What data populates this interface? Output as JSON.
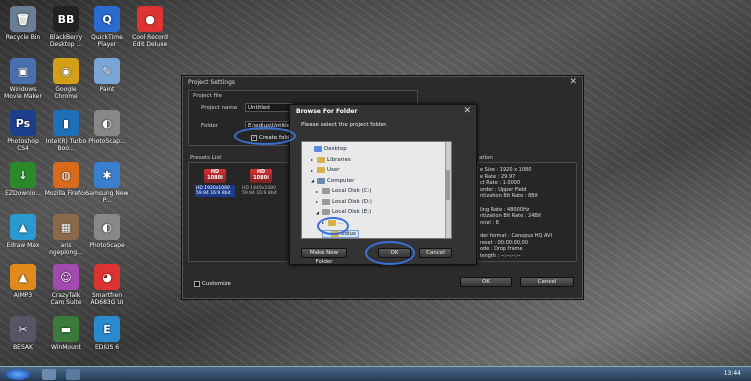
{
  "desktop": {
    "icons": [
      {
        "label": "Recycle Bin",
        "glyph": "🗑",
        "color": "#6a7f95"
      },
      {
        "label": "BlackBerry Desktop ...",
        "glyph": "BB",
        "color": "#222"
      },
      {
        "label": "QuickTime Player",
        "glyph": "Q",
        "color": "#2a6bd0"
      },
      {
        "label": "Cool Record Edit Deluxe",
        "glyph": "●",
        "color": "#d33"
      },
      {
        "label": "Windows Movie Maker",
        "glyph": "▣",
        "color": "#4a6fb0"
      },
      {
        "label": "Google Chrome",
        "glyph": "◉",
        "color": "#d4a017"
      },
      {
        "label": "Paint",
        "glyph": "✎",
        "color": "#7aa6d6"
      },
      {
        "label": "Photoshop CS4",
        "glyph": "Ps",
        "color": "#1c3f8c"
      },
      {
        "label": "Intel(R) Turbo Boo...",
        "glyph": "▮",
        "color": "#1e6fb8"
      },
      {
        "label": "PhotoScap...",
        "glyph": "◐",
        "color": "#888"
      },
      {
        "label": "EZDownlo...",
        "glyph": "↓",
        "color": "#2a8a2a"
      },
      {
        "label": "Mozilla Firefox",
        "glyph": "◍",
        "color": "#d86a1c"
      },
      {
        "label": "Samsung New P...",
        "glyph": "✱",
        "color": "#3a7fcf"
      },
      {
        "label": "Edraw Max",
        "glyph": "▲",
        "color": "#2a9ad0"
      },
      {
        "label": "aris ngeplong...",
        "glyph": "▦",
        "color": "#8a6a4a"
      },
      {
        "label": "PhotoScape",
        "glyph": "◐",
        "color": "#888"
      },
      {
        "label": "AIMP3",
        "glyph": "▲",
        "color": "#e08a1c"
      },
      {
        "label": "CrazyTalk Cam Suite",
        "glyph": "☺",
        "color": "#a24ab0"
      },
      {
        "label": "Smartfren AD683G UI",
        "glyph": "◕",
        "color": "#d33"
      },
      {
        "label": "BESAK",
        "glyph": "✂",
        "color": "#556"
      },
      {
        "label": "WinMount",
        "glyph": "▬",
        "color": "#3a7a3a"
      },
      {
        "label": "EDIUS 6",
        "glyph": "E",
        "color": "#2a8ad0"
      }
    ]
  },
  "project_settings": {
    "title": "Project Settings",
    "close": "✕",
    "project_file_label": "Project file",
    "project_name_label": "Project name",
    "project_name_value": "Untitled",
    "folder_label": "Folder",
    "folder_value": "E:\\edius\\Untitled",
    "create_folder_label": "Create folder",
    "create_folder_mark": "✓",
    "presets_list_label": "Presets List",
    "presets": [
      {
        "badge": "HD 1080i",
        "caption": "HD 1920x1080 59.94 16:9 8bit"
      },
      {
        "badge": "HD 1080i",
        "caption": "HD 1440x1080 59.94 16:9 8bit"
      }
    ],
    "info_title": "ation",
    "info_lines": [
      "e Size : 1920 x 1080",
      "e Rate : 29.97",
      "ct Rate : 1.0000",
      " order : Upper Field",
      "ntization Bit Rate : 8Bit",
      "",
      "ling Rate : 48000Hz",
      "ntization Bit Rate : 24Bit",
      "nnel : 8",
      "",
      "der format : Canopus HQ AVI",
      "reset : 00:00:00;00",
      "ode : Drop frame",
      " length : --:--:--;--"
    ],
    "customize_label": "Customize",
    "ok_label": "OK",
    "cancel_label": "Cancel"
  },
  "browse_dialog": {
    "title": "Browse For Folder",
    "close": "✕",
    "prompt": "Please select the project folder.",
    "tree": [
      {
        "label": "Desktop",
        "prefix": "",
        "icon": "#5a8ad8"
      },
      {
        "label": "Libraries",
        "prefix": "▸",
        "icon": "#d8b04a"
      },
      {
        "label": "User",
        "prefix": "▸",
        "icon": "#d8b04a"
      },
      {
        "label": "Computer",
        "prefix": "◢",
        "icon": "#6a8aa8"
      },
      {
        "label": "Local Disk (C:)",
        "prefix": "▸",
        "icon": "#999"
      },
      {
        "label": "Local Disk (D:)",
        "prefix": "▸",
        "icon": "#999"
      },
      {
        "label": "Local Disk (E:)",
        "prefix": "◢",
        "icon": "#999"
      },
      {
        "label": "...",
        "prefix": "▸",
        "icon": "#d8b04a"
      },
      {
        "label": "edius",
        "prefix": "",
        "icon": "#d8b04a"
      }
    ],
    "make_new_folder_label": "Make New Folder",
    "ok_label": "OK",
    "cancel_label": "Cancel"
  },
  "taskbar": {
    "clock": "13:44"
  }
}
